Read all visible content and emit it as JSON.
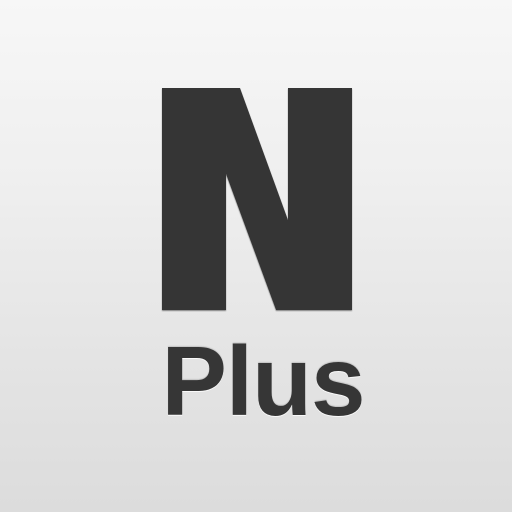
{
  "app_icon": {
    "mark_letter": "N",
    "word": "Plus"
  },
  "colors": {
    "background_top": "#f7f7f7",
    "background_bottom": "#dcdcdc",
    "glyph": "#363636"
  }
}
